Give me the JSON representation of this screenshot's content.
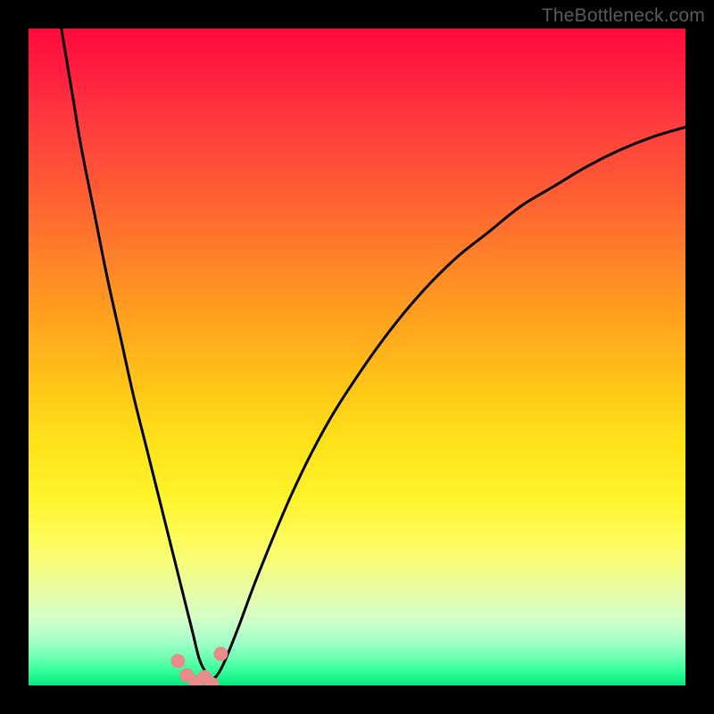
{
  "watermark": {
    "text": "TheBottleneck.com"
  },
  "chart_data": {
    "type": "line",
    "title": "",
    "xlabel": "",
    "ylabel": "",
    "xlim": [
      0,
      100
    ],
    "ylim": [
      0,
      100
    ],
    "grid": false,
    "legend": false,
    "background": "vertical red-to-green gradient (bottleneck zones)",
    "minimum_marker": {
      "x": 26,
      "marker_count": 6,
      "marker_color": "#e98b8b",
      "note": "cluster of pink filled circles at curve minimum"
    },
    "series": [
      {
        "name": "bottleneck-curve",
        "color": "#000000",
        "x": [
          5,
          6,
          7,
          8,
          10,
          12,
          14,
          16,
          18,
          20,
          22,
          24,
          25,
          26,
          27,
          28,
          29,
          30,
          32,
          35,
          40,
          45,
          50,
          55,
          60,
          65,
          70,
          75,
          80,
          85,
          90,
          95,
          100
        ],
        "values": [
          100,
          94,
          88,
          82,
          72,
          62,
          53,
          44,
          36,
          28,
          20,
          12,
          8,
          4,
          2,
          1,
          2,
          4,
          9,
          17,
          29,
          39,
          47,
          54,
          60,
          65,
          69,
          73,
          76,
          79,
          81.5,
          83.5,
          85
        ]
      }
    ]
  }
}
